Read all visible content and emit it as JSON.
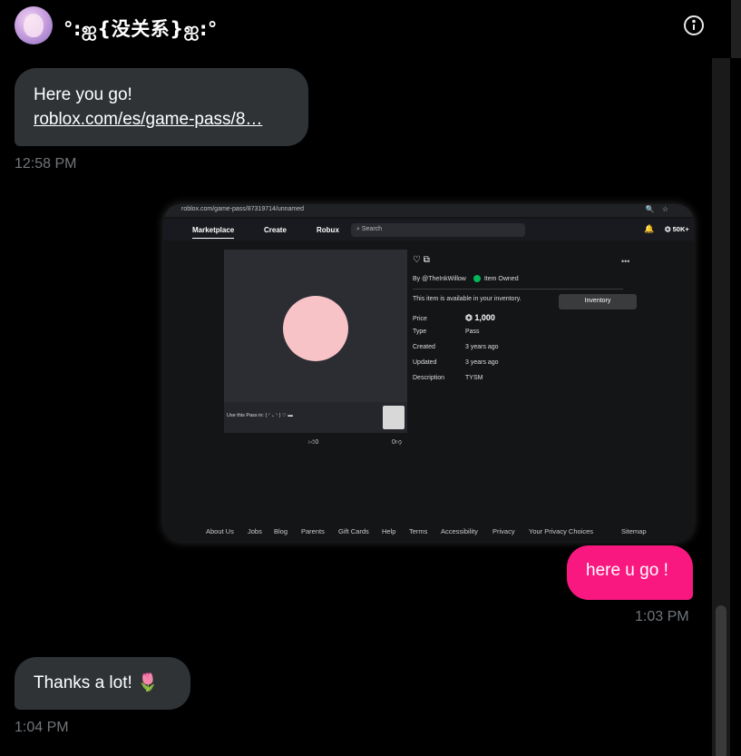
{
  "header": {
    "conversation_name": "°:ஐ{没关系}ஐ:°",
    "info_icon": "info-icon"
  },
  "messages": [
    {
      "direction": "incoming",
      "text": "Here you go!",
      "link": "roblox.com/es/game-pass/8…",
      "timestamp": "12:58 PM"
    },
    {
      "direction": "outgoing",
      "text": "here u go !",
      "timestamp": "1:03 PM"
    },
    {
      "direction": "incoming",
      "text": "Thanks a lot! 🌷",
      "timestamp": "1:04 PM"
    }
  ],
  "screenshot": {
    "url": "roblox.com/game-pass/87319714/unnamed",
    "nav_tabs": [
      "Marketplace",
      "Create",
      "Robux"
    ],
    "search_placeholder": "Search",
    "robux_balance": "50K+",
    "card_footer": "Use this Pass in: ( ◜ ₊ ◝ ) ♡ ▬",
    "likes": "0",
    "dislikes": "0",
    "by": "By @TheInkWillow",
    "owned": "Item Owned",
    "available_text": "This item is available in your inventory.",
    "inventory_button": "Inventory",
    "details": [
      {
        "key": "Price",
        "value": "⏣ 1,000"
      },
      {
        "key": "Type",
        "value": "Pass"
      },
      {
        "key": "Created",
        "value": "3 years ago"
      },
      {
        "key": "Updated",
        "value": "3 years ago"
      },
      {
        "key": "Description",
        "value": "TYSM"
      }
    ],
    "footer_links": [
      "About Us",
      "Jobs",
      "Blog",
      "Parents",
      "Gift Cards",
      "Help",
      "Terms",
      "Accessibility",
      "Privacy",
      "Your Privacy Choices",
      "Sitemap"
    ]
  },
  "colors": {
    "outgoing_bubble": "#f91880",
    "incoming_bubble": "#2f3336",
    "timestamp": "#71767b"
  }
}
